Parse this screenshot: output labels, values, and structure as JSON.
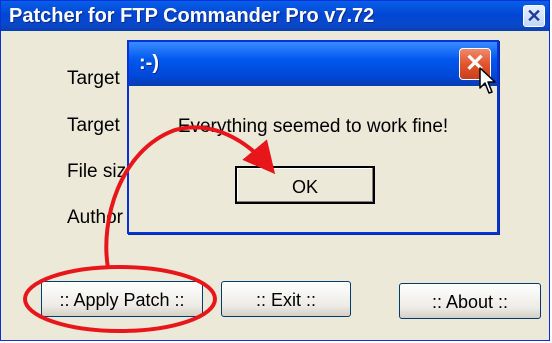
{
  "main_window": {
    "title": "Patcher for FTP Commander Pro v7.72",
    "close_glyph": "✕",
    "fields": [
      "Target",
      "Target",
      "File siz",
      "Author"
    ],
    "buttons": {
      "apply": ":: Apply Patch ::",
      "exit": ":: Exit ::",
      "about": ":: About ::"
    }
  },
  "dialog": {
    "title": ":-)",
    "close_glyph": "✕",
    "message": "Everything seemed to work fine!",
    "ok_label": "OK"
  },
  "colors": {
    "xp_blue": "#0046d5",
    "close_red": "#e0552f",
    "annotation_red": "#e8161b",
    "window_face": "#ece9d8"
  }
}
